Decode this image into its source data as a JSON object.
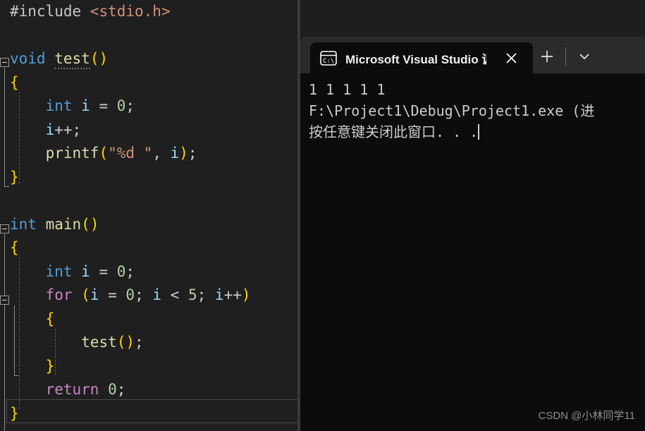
{
  "editor": {
    "lines": [
      {
        "indent": 0,
        "tokens": [
          {
            "t": "#include ",
            "c": "k-gray"
          },
          {
            "t": "<stdio.h>",
            "c": "k-str"
          }
        ]
      },
      {
        "indent": 0,
        "tokens": []
      },
      {
        "indent": 0,
        "tokens": [
          {
            "t": "void",
            "c": "k-blue"
          },
          {
            "t": " ",
            "c": "k-plain"
          },
          {
            "t": "test",
            "c": "k-fn squiggle-dot"
          },
          {
            "t": "()",
            "c": "k-br1"
          }
        ]
      },
      {
        "indent": 0,
        "tokens": [
          {
            "t": "{",
            "c": "k-br1"
          }
        ]
      },
      {
        "indent": 1,
        "tokens": [
          {
            "t": "int",
            "c": "k-blue"
          },
          {
            "t": " ",
            "c": "k-plain"
          },
          {
            "t": "i",
            "c": "k-var"
          },
          {
            "t": " = ",
            "c": "k-plain"
          },
          {
            "t": "0",
            "c": "k-num"
          },
          {
            "t": ";",
            "c": "k-plain"
          }
        ]
      },
      {
        "indent": 1,
        "tokens": [
          {
            "t": "i",
            "c": "k-var"
          },
          {
            "t": "++;",
            "c": "k-plain"
          }
        ]
      },
      {
        "indent": 1,
        "tokens": [
          {
            "t": "printf",
            "c": "k-fn"
          },
          {
            "t": "(",
            "c": "k-br1"
          },
          {
            "t": "\"%d \"",
            "c": "k-str"
          },
          {
            "t": ", ",
            "c": "k-plain"
          },
          {
            "t": "i",
            "c": "k-var"
          },
          {
            "t": ")",
            "c": "k-br1"
          },
          {
            "t": ";",
            "c": "k-plain"
          }
        ]
      },
      {
        "indent": 0,
        "tokens": [
          {
            "t": "}",
            "c": "k-br1"
          }
        ]
      },
      {
        "indent": 0,
        "tokens": []
      },
      {
        "indent": 0,
        "tokens": [
          {
            "t": "int",
            "c": "k-blue"
          },
          {
            "t": " ",
            "c": "k-plain"
          },
          {
            "t": "main",
            "c": "k-fn"
          },
          {
            "t": "()",
            "c": "k-br1"
          }
        ]
      },
      {
        "indent": 0,
        "tokens": [
          {
            "t": "{",
            "c": "k-br1"
          }
        ]
      },
      {
        "indent": 1,
        "tokens": [
          {
            "t": "int",
            "c": "k-blue"
          },
          {
            "t": " ",
            "c": "k-plain"
          },
          {
            "t": "i",
            "c": "k-var"
          },
          {
            "t": " = ",
            "c": "k-plain"
          },
          {
            "t": "0",
            "c": "k-num"
          },
          {
            "t": ";",
            "c": "k-plain"
          }
        ]
      },
      {
        "indent": 1,
        "tokens": [
          {
            "t": "for",
            "c": "k-pink"
          },
          {
            "t": " ",
            "c": "k-plain"
          },
          {
            "t": "(",
            "c": "k-br1"
          },
          {
            "t": "i",
            "c": "k-var"
          },
          {
            "t": " = ",
            "c": "k-plain"
          },
          {
            "t": "0",
            "c": "k-num"
          },
          {
            "t": "; ",
            "c": "k-plain"
          },
          {
            "t": "i",
            "c": "k-var"
          },
          {
            "t": " < ",
            "c": "k-plain"
          },
          {
            "t": "5",
            "c": "k-num"
          },
          {
            "t": "; ",
            "c": "k-plain"
          },
          {
            "t": "i",
            "c": "k-var"
          },
          {
            "t": "++",
            "c": "k-plain"
          },
          {
            "t": ")",
            "c": "k-br1"
          }
        ]
      },
      {
        "indent": 1,
        "tokens": [
          {
            "t": "{",
            "c": "k-br1"
          }
        ]
      },
      {
        "indent": 2,
        "tokens": [
          {
            "t": "test",
            "c": "k-fn"
          },
          {
            "t": "()",
            "c": "k-br1"
          },
          {
            "t": ";",
            "c": "k-plain"
          }
        ]
      },
      {
        "indent": 1,
        "tokens": [
          {
            "t": "}",
            "c": "k-br1"
          }
        ]
      },
      {
        "indent": 1,
        "tokens": [
          {
            "t": "return",
            "c": "k-pink"
          },
          {
            "t": " ",
            "c": "k-plain"
          },
          {
            "t": "0",
            "c": "k-num"
          },
          {
            "t": ";",
            "c": "k-plain"
          }
        ]
      },
      {
        "indent": 0,
        "tokens": [
          {
            "t": "}",
            "c": "k-br1"
          }
        ]
      }
    ],
    "plain_text": "#include <stdio.h>\n\nvoid test()\n{\n    int i = 0;\n    i++;\n    printf(\"%d \", i);\n}\n\nint main()\n{\n    int i = 0;\n    for (i = 0; i < 5; i++)\n    {\n        test();\n    }\n    return 0;\n}",
    "fold_markers": [
      {
        "line": 2,
        "state": "expanded"
      },
      {
        "line": 9,
        "state": "expanded"
      },
      {
        "line": 12,
        "state": "expanded"
      }
    ],
    "current_line_index": 17,
    "colors": {
      "background": "#1f1f1f",
      "keyword": "#569cd6",
      "control_keyword": "#c586c0",
      "function": "#dcdcaa",
      "variable": "#9cdcfe",
      "number": "#b5cea8",
      "string": "#ce9178",
      "preprocessor": "#c8c8c8",
      "bracket": "#ffd702",
      "plain": "#cccccc"
    }
  },
  "terminal": {
    "tab": {
      "icon": "console-cmd-icon",
      "title": "Microsoft Visual Studio 调试控",
      "close_label": "✕"
    },
    "titlebar": {
      "new_tab_label": "+",
      "dropdown_label": "⌄"
    },
    "output_lines": [
      "1 1 1 1 1 ",
      "F:\\Project1\\Debug\\Project1.exe (进",
      "按任意键关闭此窗口. . ."
    ],
    "colors": {
      "titlebar_background": "#2b2b2b",
      "body_background": "#0c0c0c",
      "text": "#cccccc"
    }
  },
  "watermark": {
    "text": "CSDN @小林同学11"
  }
}
